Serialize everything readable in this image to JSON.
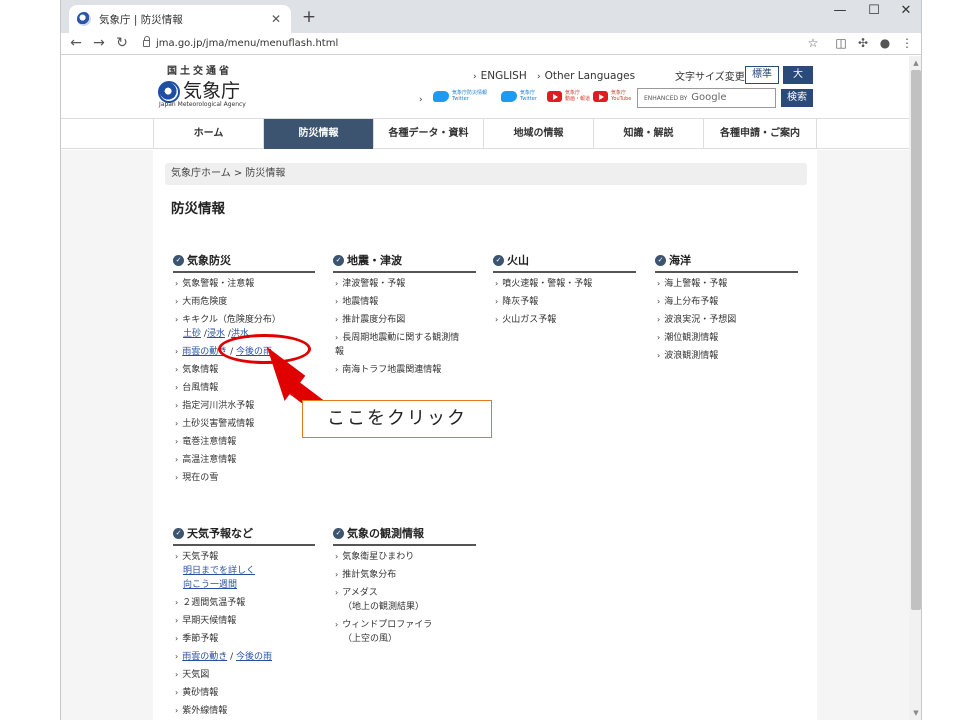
{
  "browser": {
    "tab_title": "気象庁 | 防災情報",
    "tab_close": "✕",
    "new_tab": "+",
    "win_min": "—",
    "win_max": "☐",
    "win_close": "✕",
    "url": "jma.go.jp/jma/menu/menuflash.html",
    "back": "←",
    "forward": "→",
    "reload": "↻",
    "star": "☆",
    "ext1": "◫",
    "ext2": "✣",
    "profile": "●",
    "menu": "⋮"
  },
  "header": {
    "ministry": "国土交通省",
    "agency": "気象庁",
    "agency_en": "Japan Meteorological Agency",
    "english_link": "ENGLISH",
    "other_lang_link": "Other Languages",
    "chev": "›",
    "font_size_label": "文字サイズ変更",
    "font_std": "標準",
    "font_large": "大",
    "search_placeholder": "ENHANCED BY",
    "google": "Google",
    "search_button": "検索",
    "sns": [
      {
        "label1": "気象庁防災情報",
        "label2": "Twitter"
      },
      {
        "label1": "気象庁",
        "label2": "Twitter"
      },
      {
        "label1": "気象庁",
        "label2": "動画・報道"
      },
      {
        "label1": "気象庁",
        "label2": "YouTube"
      }
    ]
  },
  "gnav": [
    {
      "label": "ホーム"
    },
    {
      "label": "防災情報"
    },
    {
      "label": "各種データ・資料"
    },
    {
      "label": "地域の情報"
    },
    {
      "label": "知識・解説"
    },
    {
      "label": "各種申請・ご案内"
    }
  ],
  "breadcrumb": "気象庁ホーム > 防災情報",
  "page_title": "防災情報",
  "check": "✓",
  "item_chev": "›",
  "sections": {
    "kisho": {
      "title": "気象防災",
      "items": [
        "気象警報・注意報",
        "大雨危険度",
        "キキクル（危険度分布）"
      ],
      "kikikuru_sub": [
        "土砂",
        "浸水",
        "洪水"
      ],
      "slash": "/",
      "rain_move": "雨雲の動き",
      "rain_future": "今後の雨",
      "items2": [
        "気象情報",
        "台風情報",
        "指定河川洪水予報",
        "土砂災害警戒情報",
        "竜巻注意情報",
        "高温注意情報",
        "現在の雪"
      ]
    },
    "jishin": {
      "title": "地震・津波",
      "items": [
        "津波警報・予報",
        "地震情報",
        "推計震度分布図",
        "長周期地震動に関する観測情"
      ],
      "item_cont": "報",
      "items2": [
        "南海トラフ地震関連情報"
      ]
    },
    "kazan": {
      "title": "火山",
      "items": [
        "噴火速報・警報・予報",
        "降灰予報",
        "火山ガス予報"
      ]
    },
    "kaiyo": {
      "title": "海洋",
      "items": [
        "海上警報・予報",
        "海上分布予報",
        "波浪実況・予想図",
        "潮位観測情報",
        "波浪観測情報"
      ]
    },
    "tenki": {
      "title": "天気予報など",
      "items": [
        "天気予報"
      ],
      "sub": [
        "明日までを詳しく",
        "向こう一週間"
      ],
      "items2": [
        "２週間気温予報",
        "早期天候情報",
        "季節予報"
      ],
      "rain_move": "雨雲の動き",
      "slash": "/",
      "rain_future": "今後の雨",
      "items3": [
        "天気図",
        "黄砂情報",
        "紫外線情報"
      ]
    },
    "kansoku": {
      "title": "気象の観測情報",
      "items": [
        "気象衛星ひまわり",
        "推計気象分布"
      ],
      "amedas": "アメダス",
      "amedas_sub": "（地上の観測結果）",
      "wind": "ウィンドプロファイラ",
      "wind_sub": "（上空の風）"
    }
  },
  "annotation": {
    "callout": "ここをクリック",
    "ring_color": "#e00000",
    "arrow_color": "#e00000",
    "callout_border": "#e07b1f"
  },
  "colors": {
    "nav_active": "#3c5470",
    "search_btn": "#2a4a7a",
    "twitter": "#1d9bf0",
    "youtube": "#e01b22"
  }
}
